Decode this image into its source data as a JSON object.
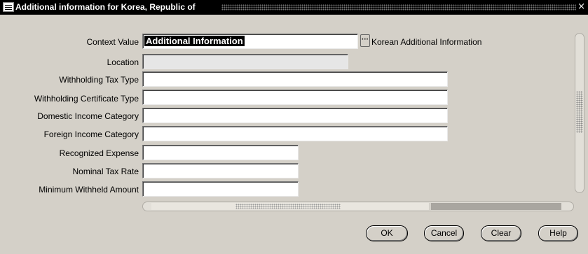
{
  "window": {
    "title": "Additional information for Korea, Republic of",
    "close_glyph": "×",
    "icon": "oracle-forms-icon"
  },
  "context": {
    "label": "Context Value",
    "value": "Additional Information",
    "lov_glyph": "···",
    "description": "Korean Additional Information"
  },
  "fields": [
    {
      "label": "Location",
      "value": "",
      "enabled": false
    },
    {
      "label": "Withholding Tax Type",
      "value": "",
      "enabled": true
    },
    {
      "label": "Withholding Certificate Type",
      "value": "",
      "enabled": true
    },
    {
      "label": "Domestic Income Category",
      "value": "",
      "enabled": true
    },
    {
      "label": "Foreign Income Category",
      "value": "",
      "enabled": true
    },
    {
      "label": "Recognized Expense",
      "value": "",
      "enabled": true
    },
    {
      "label": "Nominal Tax Rate",
      "value": "",
      "enabled": true
    },
    {
      "label": "Minimum Withheld Amount",
      "value": "",
      "enabled": true
    }
  ],
  "buttons": {
    "ok": "OK",
    "cancel": "Cancel",
    "clear": "Clear",
    "help": "Help"
  },
  "colors": {
    "background": "#d4d0c8",
    "titlebar": "#000000",
    "selection": "#000000"
  }
}
